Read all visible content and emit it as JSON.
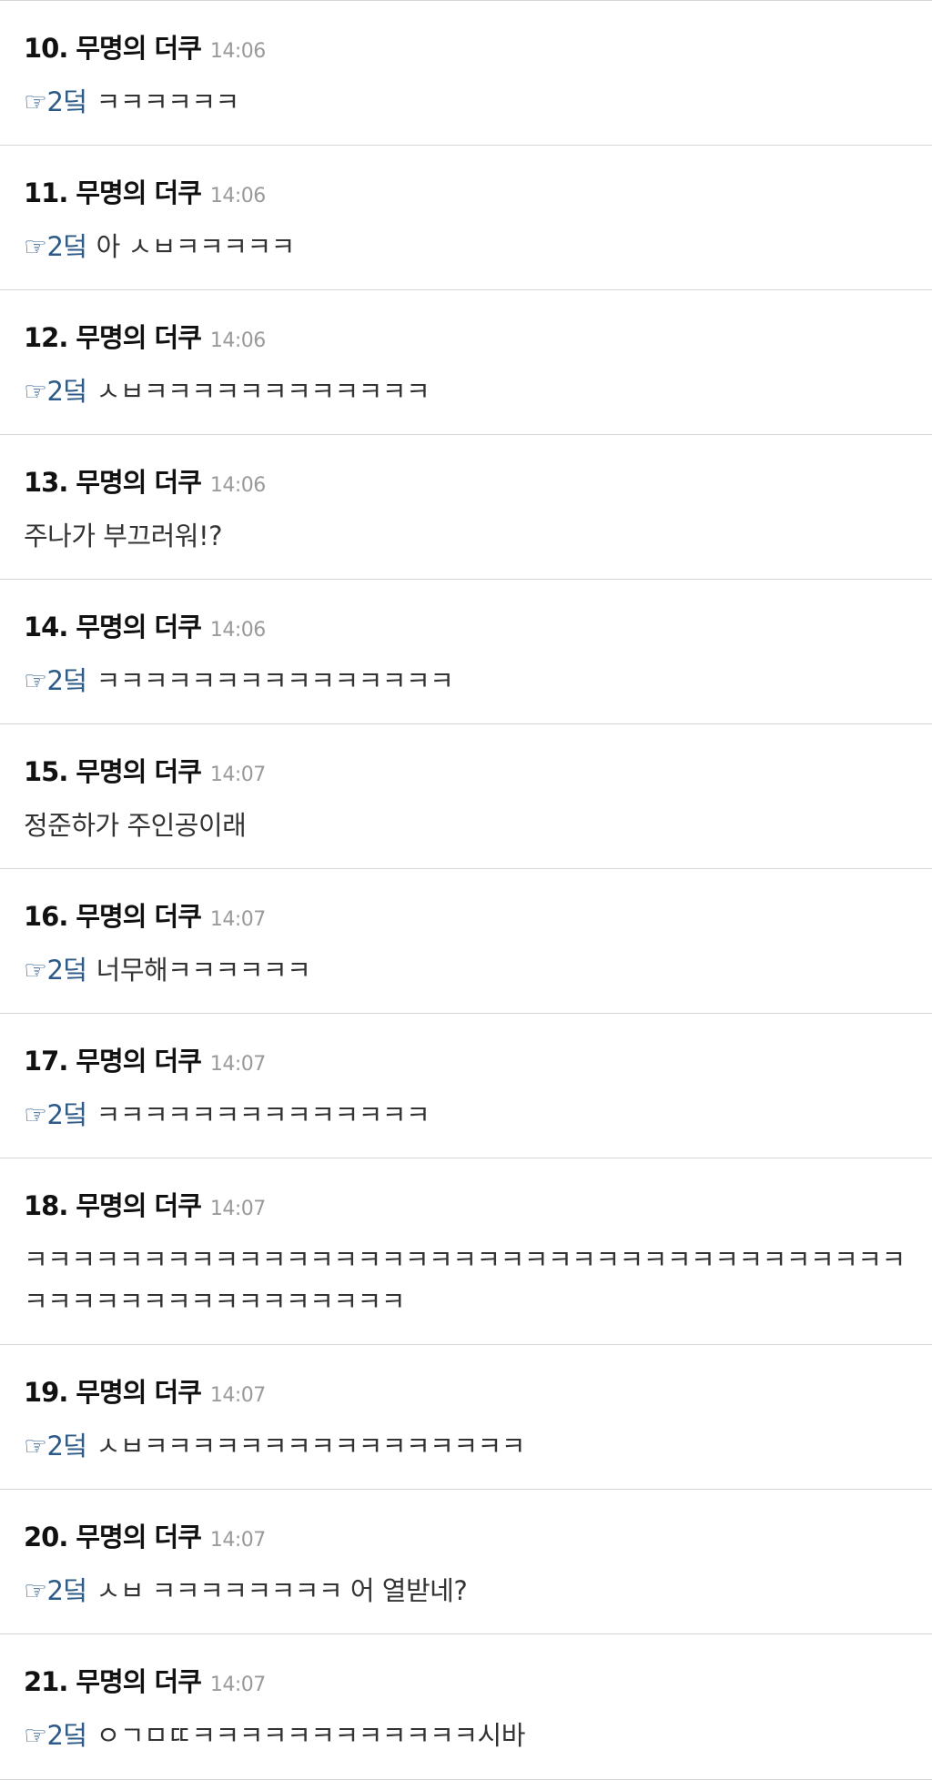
{
  "comments": [
    {
      "number": "10.",
      "nickname": "무명의 더쿠",
      "time": "14:06",
      "reply_to": "☞2덬",
      "text": "ㅋㅋㅋㅋㅋㅋ"
    },
    {
      "number": "11.",
      "nickname": "무명의 더쿠",
      "time": "14:06",
      "reply_to": "☞2덬",
      "text": "아 ㅅㅂㅋㅋㅋㅋㅋ"
    },
    {
      "number": "12.",
      "nickname": "무명의 더쿠",
      "time": "14:06",
      "reply_to": "☞2덬",
      "text": "ㅅㅂㅋㅋㅋㅋㅋㅋㅋㅋㅋㅋㅋㅋ"
    },
    {
      "number": "13.",
      "nickname": "무명의 더쿠",
      "time": "14:06",
      "reply_to": "",
      "text": "주나가 부끄러워!?"
    },
    {
      "number": "14.",
      "nickname": "무명의 더쿠",
      "time": "14:06",
      "reply_to": "☞2덬",
      "text": "ㅋㅋㅋㅋㅋㅋㅋㅋㅋㅋㅋㅋㅋㅋㅋ"
    },
    {
      "number": "15.",
      "nickname": "무명의 더쿠",
      "time": "14:07",
      "reply_to": "",
      "text": "정준하가 주인공이래"
    },
    {
      "number": "16.",
      "nickname": "무명의 더쿠",
      "time": "14:07",
      "reply_to": "☞2덬",
      "text": "너무해ㅋㅋㅋㅋㅋㅋ"
    },
    {
      "number": "17.",
      "nickname": "무명의 더쿠",
      "time": "14:07",
      "reply_to": "☞2덬",
      "text": "ㅋㅋㅋㅋㅋㅋㅋㅋㅋㅋㅋㅋㅋㅋ"
    },
    {
      "number": "18.",
      "nickname": "무명의 더쿠",
      "time": "14:07",
      "reply_to": "",
      "text": "ㅋㅋㅋㅋㅋㅋㅋㅋㅋㅋㅋㅋㅋㅋㅋㅋㅋㅋㅋㅋㅋㅋㅋㅋㅋㅋㅋㅋㅋㅋㅋㅋㅋㅋㅋㅋㅋㅋㅋㅋㅋㅋㅋㅋㅋㅋㅋㅋㅋㅋㅋㅋㅋ"
    },
    {
      "number": "19.",
      "nickname": "무명의 더쿠",
      "time": "14:07",
      "reply_to": "☞2덬",
      "text": "ㅅㅂㅋㅋㅋㅋㅋㅋㅋㅋㅋㅋㅋㅋㅋㅋㅋㅋ"
    },
    {
      "number": "20.",
      "nickname": "무명의 더쿠",
      "time": "14:07",
      "reply_to": "☞2덬",
      "text": "ㅅㅂ ㅋㅋㅋㅋㅋㅋㅋㅋ 어 열받네?"
    },
    {
      "number": "21.",
      "nickname": "무명의 더쿠",
      "time": "14:07",
      "reply_to": "☞2덬",
      "text": "ㅇㄱㅁㄸㅋㅋㅋㅋㅋㅋㅋㅋㅋㅋㅋㅋ시바"
    }
  ],
  "colors": {
    "reply_link": "#2d5a86",
    "timestamp": "#9a9a9a",
    "divider": "#d6d6d6"
  }
}
